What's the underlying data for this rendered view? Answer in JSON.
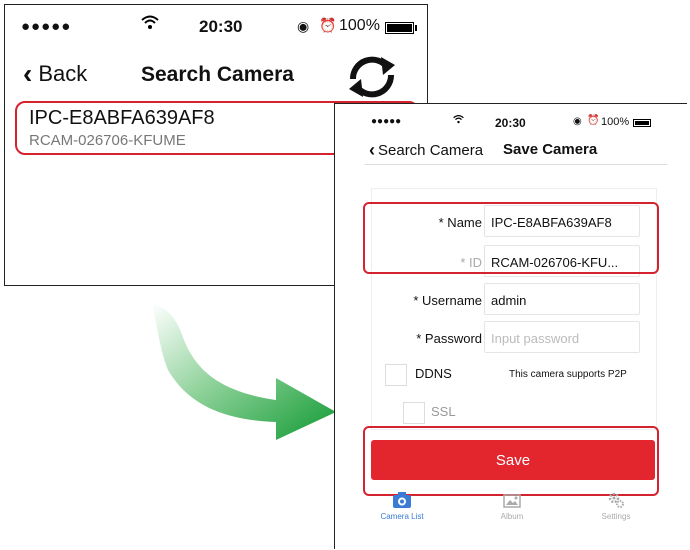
{
  "left_screen": {
    "status": {
      "signal": "●●●●●",
      "time": "20:30",
      "battery_text": "100%"
    },
    "nav": {
      "back_label": "Back",
      "title": "Search Camera"
    },
    "result": {
      "name": "IPC-E8ABFA639AF8",
      "id": "RCAM-026706-KFUME"
    }
  },
  "right_screen": {
    "status": {
      "signal": "●●●●●",
      "time": "20:30",
      "battery_text": "100%"
    },
    "nav": {
      "back_label": "Search Camera",
      "title": "Save Camera"
    },
    "form": {
      "name_label": "* Name",
      "name_value": "IPC-E8ABFA639AF8",
      "id_label": "* ID",
      "id_value": "RCAM-026706-KFU...",
      "username_label": "* Username",
      "username_value": "admin",
      "password_label": "* Password",
      "password_placeholder": "Input password",
      "ddns_label": "DDNS",
      "p2p_note": "This camera supports P2P",
      "ssl_label": "SSL"
    },
    "save_label": "Save",
    "tabs": [
      {
        "label": "Camera List",
        "icon": "camera-icon",
        "active": true
      },
      {
        "label": "Album",
        "icon": "album-icon",
        "active": false
      },
      {
        "label": "Settings",
        "icon": "gear-icon",
        "active": false
      }
    ]
  },
  "colors": {
    "accent_red": "#e3252d",
    "tab_active": "#3a7bd5",
    "arrow_green": "#1e9e3a"
  }
}
